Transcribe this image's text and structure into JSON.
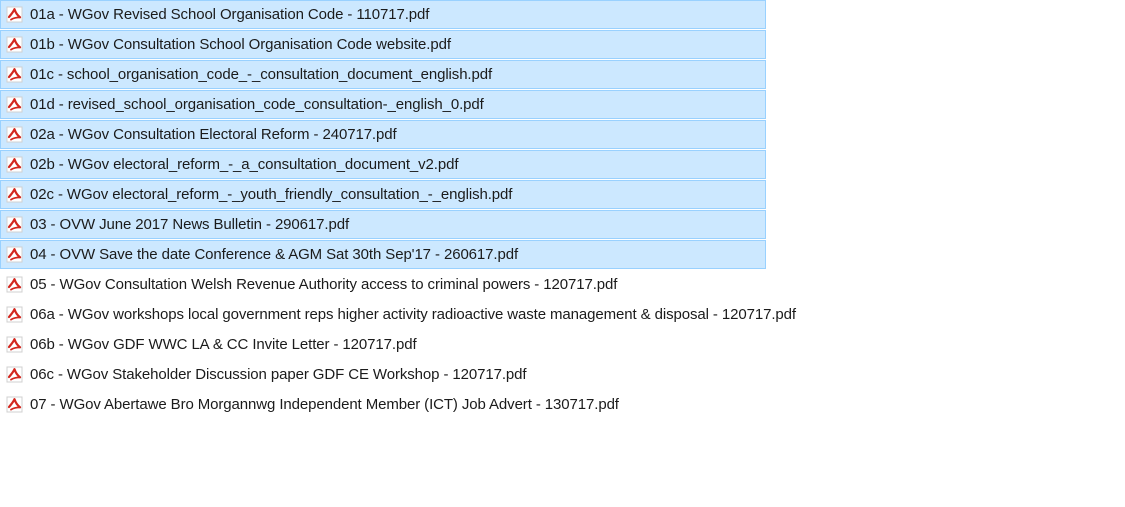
{
  "files": [
    {
      "name": "01a - WGov Revised School Organisation Code - 110717.pdf",
      "selected": true,
      "icon": "pdf-file-icon"
    },
    {
      "name": "01b - WGov Consultation School Organisation Code website.pdf",
      "selected": true,
      "icon": "pdf-file-icon"
    },
    {
      "name": "01c - school_organisation_code_-_consultation_document_english.pdf",
      "selected": true,
      "icon": "pdf-file-icon"
    },
    {
      "name": "01d - revised_school_organisation_code_consultation-_english_0.pdf",
      "selected": true,
      "icon": "pdf-file-icon"
    },
    {
      "name": "02a - WGov Consultation Electoral Reform - 240717.pdf",
      "selected": true,
      "icon": "pdf-file-icon"
    },
    {
      "name": "02b - WGov electoral_reform_-_a_consultation_document_v2.pdf",
      "selected": true,
      "icon": "pdf-file-icon"
    },
    {
      "name": "02c - WGov electoral_reform_-_youth_friendly_consultation_-_english.pdf",
      "selected": true,
      "icon": "pdf-file-icon"
    },
    {
      "name": "03 - OVW June 2017 News Bulletin - 290617.pdf",
      "selected": true,
      "icon": "pdf-file-icon"
    },
    {
      "name": "04 - OVW Save the date Conference & AGM Sat 30th Sep'17 - 260617.pdf",
      "selected": true,
      "icon": "pdf-file-icon"
    },
    {
      "name": "05 - WGov Consultation Welsh Revenue Authority access to criminal powers - 120717.pdf",
      "selected": false,
      "icon": "pdf-file-icon"
    },
    {
      "name": "06a - WGov workshops local government reps higher activity radioactive waste management & disposal - 120717.pdf",
      "selected": false,
      "icon": "pdf-file-icon"
    },
    {
      "name": "06b - WGov GDF WWC LA & CC Invite Letter - 120717.pdf",
      "selected": false,
      "icon": "pdf-file-icon"
    },
    {
      "name": "06c - WGov Stakeholder Discussion paper GDF CE Workshop - 120717.pdf",
      "selected": false,
      "icon": "pdf-file-icon"
    },
    {
      "name": "07 - WGov Abertawe Bro Morgannwg Independent Member (ICT) Job  Advert - 130717.pdf",
      "selected": false,
      "icon": "pdf-file-icon"
    }
  ],
  "colors": {
    "selection_background": "#cce8ff",
    "selection_border": "#99d1ff",
    "pdf_icon_red": "#d3271f",
    "text": "#1b1b1b"
  }
}
